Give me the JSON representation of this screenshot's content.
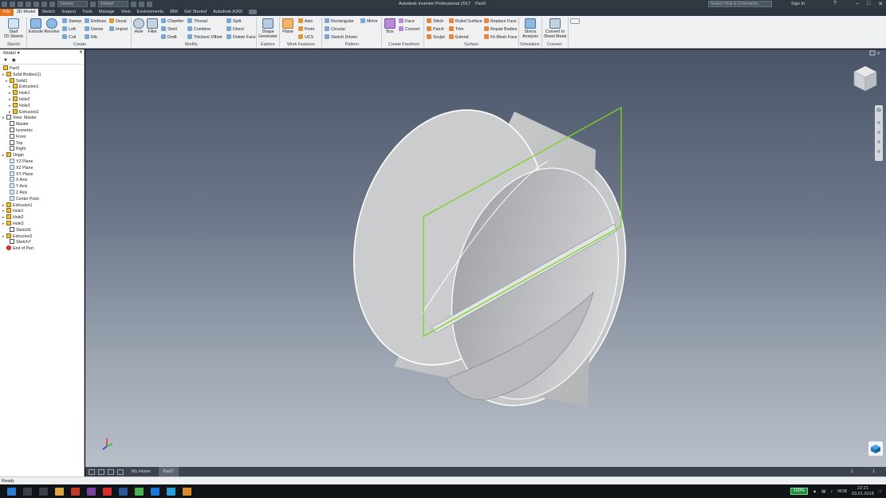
{
  "titlebar": {
    "app_title": "Autodesk Inventor Professional 2017",
    "doc_name": "Part2",
    "material_combo": "Generic",
    "appearance_combo": "Default",
    "search_placeholder": "Search Help & Commands...",
    "signin": "Sign In",
    "help_glyph": "?"
  },
  "tabs": [
    {
      "label": "File"
    },
    {
      "label": "3D Model"
    },
    {
      "label": "Sketch"
    },
    {
      "label": "Inspect"
    },
    {
      "label": "Tools"
    },
    {
      "label": "Manage"
    },
    {
      "label": "View"
    },
    {
      "label": "Environments"
    },
    {
      "label": "BIM"
    },
    {
      "label": "Get Started"
    },
    {
      "label": "Autodesk A360"
    }
  ],
  "ribbon": {
    "sketch": {
      "start": "Start",
      "sketch2d": "2D Sketch",
      "group": "Sketch"
    },
    "create": {
      "extrude": "Extrude",
      "revolve": "Revolve",
      "sweep": "Sweep",
      "loft": "Loft",
      "coil": "Coil",
      "emboss": "Emboss",
      "derive": "Derive",
      "rib": "Rib",
      "decal": "Decal",
      "import": "Import",
      "group": "Create"
    },
    "modify": {
      "hole": "Hole",
      "fillet": "Fillet",
      "chamfer": "Chamfer",
      "shell": "Shell",
      "draft": "Draft",
      "thread": "Thread",
      "combine": "Combine",
      "thicken": "Thicken/ Offset",
      "split": "Split",
      "direct": "Direct",
      "delete_face": "Delete Face",
      "group": "Modify"
    },
    "explore": {
      "shape1": "Shape",
      "shape2": "Generator",
      "group": "Explore"
    },
    "work": {
      "plane": "Plane",
      "axis": "Axis",
      "point": "Point",
      "ucs": "UCS",
      "group": "Work Features"
    },
    "pattern": {
      "rectangular": "Rectangular",
      "circular": "Circular",
      "sketch_driven": "Sketch Driven",
      "mirror": "Mirror",
      "group": "Pattern"
    },
    "freeform": {
      "box": "Box",
      "face": "Face",
      "convert": "Convert",
      "group": "Create Freeform"
    },
    "surface": {
      "stitch": "Stitch",
      "patch": "Patch",
      "sculpt": "Sculpt",
      "ruled": "Ruled Surface",
      "trim": "Trim",
      "extend": "Extend",
      "replace": "Replace Face",
      "repair": "Repair Bodies",
      "fitmesh": "Fit Mesh Face",
      "group": "Surface"
    },
    "simulation": {
      "stress1": "Stress",
      "stress2": "Analysis",
      "group": "Simulation"
    },
    "convert": {
      "c1": "Convert to",
      "c2": "Sheet Metal",
      "group": "Convert"
    }
  },
  "browser": {
    "title": "Model",
    "tree": [
      {
        "label": "Part2",
        "type": "part"
      },
      {
        "label": "Solid Bodies(1)",
        "type": "folder"
      },
      {
        "label": "Solid1",
        "type": "body"
      },
      {
        "label": "Extrusion1",
        "type": "feature"
      },
      {
        "label": "Hole1",
        "type": "feature"
      },
      {
        "label": "Hole2",
        "type": "feature"
      },
      {
        "label": "Hole3",
        "type": "feature"
      },
      {
        "label": "Extrusion2",
        "type": "feature"
      },
      {
        "label": "View: Master",
        "type": "view"
      },
      {
        "label": "Master",
        "type": "view"
      },
      {
        "label": "Isometric",
        "type": "view"
      },
      {
        "label": "Front",
        "type": "view"
      },
      {
        "label": "Top",
        "type": "view"
      },
      {
        "label": "Right",
        "type": "view"
      },
      {
        "label": "Origin",
        "type": "folder"
      },
      {
        "label": "YZ Plane",
        "type": "plane"
      },
      {
        "label": "XZ Plane",
        "type": "plane"
      },
      {
        "label": "XY Plane",
        "type": "plane"
      },
      {
        "label": "X Axis",
        "type": "plane"
      },
      {
        "label": "Y Axis",
        "type": "plane"
      },
      {
        "label": "Z Axis",
        "type": "plane"
      },
      {
        "label": "Center Point",
        "type": "plane"
      },
      {
        "label": "Extrusion1",
        "type": "feature"
      },
      {
        "label": "Hole1",
        "type": "feature"
      },
      {
        "label": "Hole2",
        "type": "feature"
      },
      {
        "label": "Hole3",
        "type": "feature"
      },
      {
        "label": "Sketch5",
        "type": "sketch"
      },
      {
        "label": "Extrusion2",
        "type": "feature"
      },
      {
        "label": "Sketch7",
        "type": "sketch"
      },
      {
        "label": "End of Part",
        "type": "end"
      }
    ]
  },
  "doctabs": {
    "home": "My Home",
    "part": "Part2",
    "n1": "1",
    "n2": "1"
  },
  "status": {
    "text": "Ready"
  },
  "taskbar": {
    "battery": "100%",
    "lang": "NOB",
    "time": "22:21",
    "date": "03.01.2018"
  }
}
